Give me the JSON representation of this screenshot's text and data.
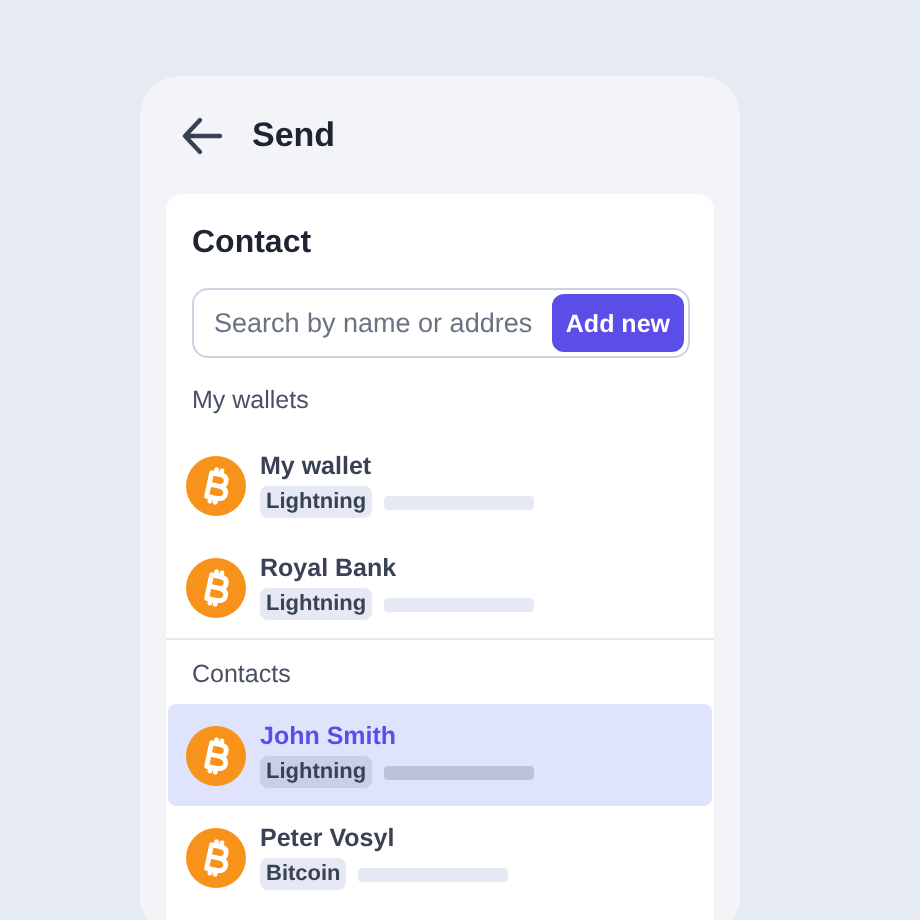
{
  "header": {
    "title": "Send"
  },
  "card": {
    "title": "Contact",
    "search": {
      "placeholder": "Search by name or addres"
    },
    "add_button": "Add new"
  },
  "sections": [
    {
      "title": "My wallets",
      "items": [
        {
          "name": "My wallet",
          "tag": "Lightning",
          "selected": false
        },
        {
          "name": "Royal Bank",
          "tag": "Lightning",
          "selected": false
        }
      ]
    },
    {
      "title": "Contacts",
      "items": [
        {
          "name": "John Smith",
          "tag": "Lightning",
          "selected": true
        },
        {
          "name": "Peter Vosyl",
          "tag": "Bitcoin",
          "selected": false
        }
      ]
    }
  ]
}
